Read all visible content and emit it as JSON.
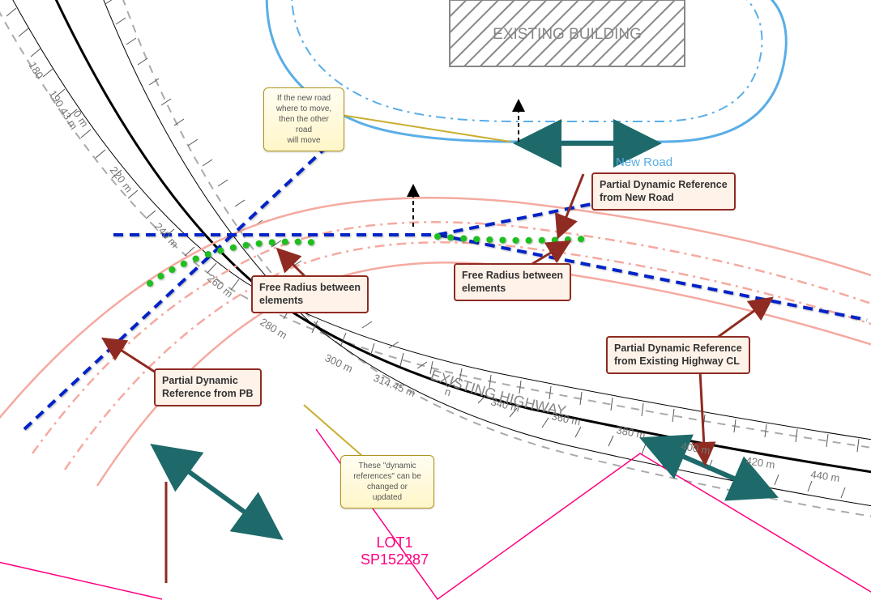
{
  "stations": {
    "upper_run": [
      "180",
      "190.43 m",
      "0 m",
      "220 m",
      "240 m",
      "260 m"
    ],
    "lower_run": [
      "280 m",
      "300 m",
      "314.45 m",
      "n",
      "340 m",
      "360 m",
      "380 m",
      "400 m",
      "420 m",
      "440 m"
    ]
  },
  "labels": {
    "existing_highway": "EXISTING HIGHWAY",
    "existing_building": "EXISTING BUILDING",
    "new_road": "New Road",
    "lot_line1": "LOT1",
    "lot_line2": "SP152287"
  },
  "callouts": {
    "pb": "Partial Dynamic\nReference from PB",
    "free_radius_left": "Free Radius between\nelements",
    "free_radius_right": "Free Radius between\nelements",
    "new_road_ref": "Partial Dynamic Reference\nfrom New Road",
    "highway_cl": "Partial Dynamic Reference\nfrom Existing Highway CL"
  },
  "notes": {
    "move": "If the new road\nwhere to move,\nthen the other road\nwill move",
    "dynamic": "These \"dynamic\nreferences\" can be\nchanged or\nupdated"
  }
}
